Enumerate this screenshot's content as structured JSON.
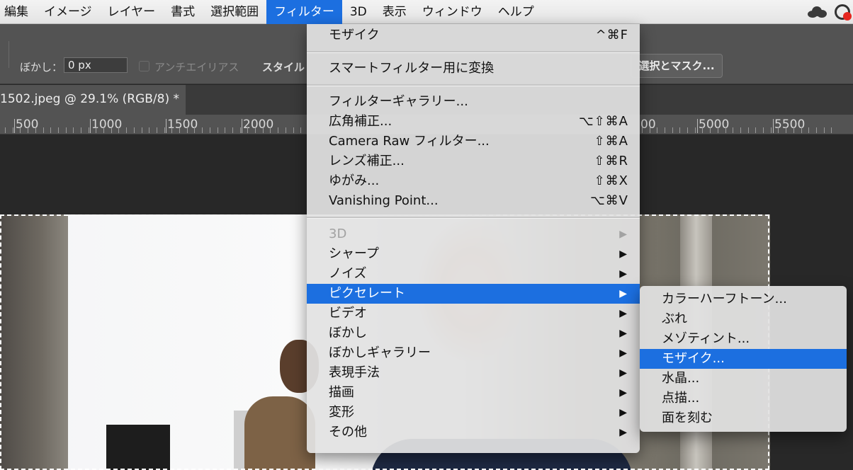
{
  "menubar": {
    "items": [
      "編集",
      "イメージ",
      "レイヤー",
      "書式",
      "選択範囲",
      "フィルター",
      "3D",
      "表示",
      "ウィンドウ",
      "ヘルプ"
    ],
    "active_index": 5
  },
  "options": {
    "blur_label": "ぼかし：",
    "blur_value": "0 px",
    "antialias_label": "アンチエイリアス",
    "style_label": "スタイル",
    "select_mask_button": "選択とマスク..."
  },
  "document": {
    "tab_title": "1502.jpeg @ 29.1% (RGB/8) *"
  },
  "ruler": {
    "labels": [
      "500",
      "1000",
      "1500",
      "2000",
      "5000",
      "5500"
    ],
    "partial_label": "00"
  },
  "filter_menu": {
    "last_filter": {
      "label": "モザイク",
      "shortcut": "^⌘F"
    },
    "convert_smart": "スマートフィルター用に変換",
    "group2": [
      {
        "label": "フィルターギャラリー...",
        "shortcut": ""
      },
      {
        "label": "広角補正...",
        "shortcut": "⌥⇧⌘A"
      },
      {
        "label": "Camera Raw フィルター...",
        "shortcut": "⇧⌘A"
      },
      {
        "label": "レンズ補正...",
        "shortcut": "⇧⌘R"
      },
      {
        "label": "ゆがみ...",
        "shortcut": "⇧⌘X"
      },
      {
        "label": "Vanishing Point...",
        "shortcut": "⌥⌘V"
      }
    ],
    "group3": [
      {
        "label": "3D",
        "disabled": true,
        "highlight": false
      },
      {
        "label": "シャープ",
        "disabled": false,
        "highlight": false
      },
      {
        "label": "ノイズ",
        "disabled": false,
        "highlight": false
      },
      {
        "label": "ピクセレート",
        "disabled": false,
        "highlight": true
      },
      {
        "label": "ビデオ",
        "disabled": false,
        "highlight": false
      },
      {
        "label": "ぼかし",
        "disabled": false,
        "highlight": false
      },
      {
        "label": "ぼかしギャラリー",
        "disabled": false,
        "highlight": false
      },
      {
        "label": "表現手法",
        "disabled": false,
        "highlight": false
      },
      {
        "label": "描画",
        "disabled": false,
        "highlight": false
      },
      {
        "label": "変形",
        "disabled": false,
        "highlight": false
      },
      {
        "label": "その他",
        "disabled": false,
        "highlight": false
      }
    ],
    "arrow_glyph": "▶"
  },
  "pixelate_submenu": {
    "items": [
      {
        "label": "カラーハーフトーン...",
        "highlight": false
      },
      {
        "label": "ぶれ",
        "highlight": false
      },
      {
        "label": "メゾティント...",
        "highlight": false
      },
      {
        "label": "モザイク...",
        "highlight": true
      },
      {
        "label": "水晶...",
        "highlight": false
      },
      {
        "label": "点描...",
        "highlight": false
      },
      {
        "label": "面を刻む",
        "highlight": false
      }
    ]
  },
  "icons": {
    "cloud": "creative-cloud-status-icon",
    "cc": "adobe-cc-icon"
  },
  "colors": {
    "menu_highlight": "#1c6fe0",
    "panel_dark": "#535353",
    "canvas_bg": "#282828"
  }
}
